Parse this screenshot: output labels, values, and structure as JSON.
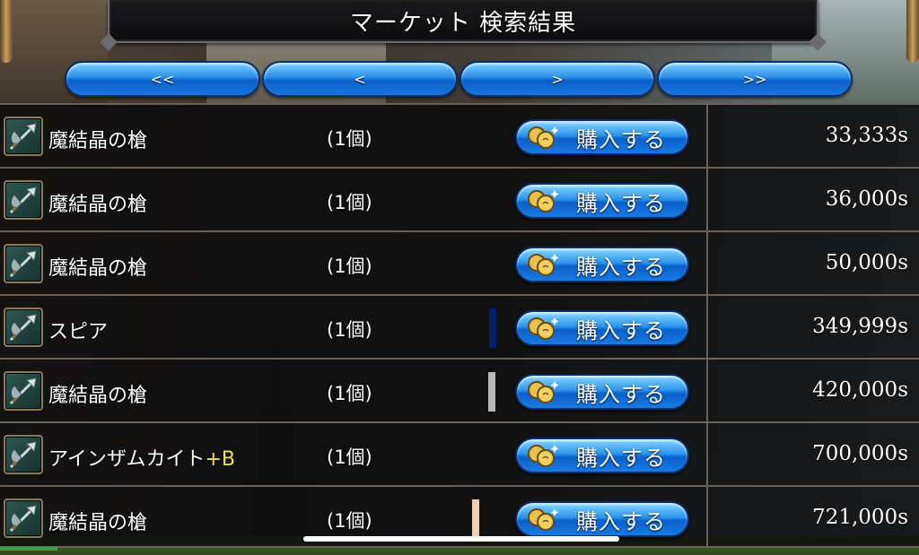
{
  "header": {
    "title": "マーケット 検索結果"
  },
  "pager": [
    {
      "label": "<<"
    },
    {
      "label": "<"
    },
    {
      "label": ">"
    },
    {
      "label": ">>"
    }
  ],
  "buy_label": "購入する",
  "rows": [
    {
      "name": "魔結晶の槍",
      "suffix": "",
      "qty": "(1個)",
      "price": "33,333s",
      "mark_color": ""
    },
    {
      "name": "魔結晶の槍",
      "suffix": "",
      "qty": "(1個)",
      "price": "36,000s",
      "mark_color": ""
    },
    {
      "name": "魔結晶の槍",
      "suffix": "",
      "qty": "(1個)",
      "price": "50,000s",
      "mark_color": ""
    },
    {
      "name": "スピア",
      "suffix": "",
      "qty": "(1個)",
      "price": "349,999s",
      "mark_color": "#0a1e6e"
    },
    {
      "name": "魔結晶の槍",
      "suffix": "",
      "qty": "(1個)",
      "price": "420,000s",
      "mark_color": "#b8b8b8"
    },
    {
      "name": "アインザムカイト",
      "suffix": "+B",
      "qty": "(1個)",
      "price": "700,000s",
      "mark_color": ""
    },
    {
      "name": "魔結晶の槍",
      "suffix": "",
      "qty": "(1個)",
      "price": "721,000s",
      "mark_color": "#f3cdb0"
    }
  ],
  "icons": {
    "item": "spear-icon",
    "coin": "coin-icon"
  },
  "colors": {
    "button_blue": "#2a8fe8",
    "suffix_yellow": "#f2e34a",
    "row_border": "#6c5f55"
  }
}
